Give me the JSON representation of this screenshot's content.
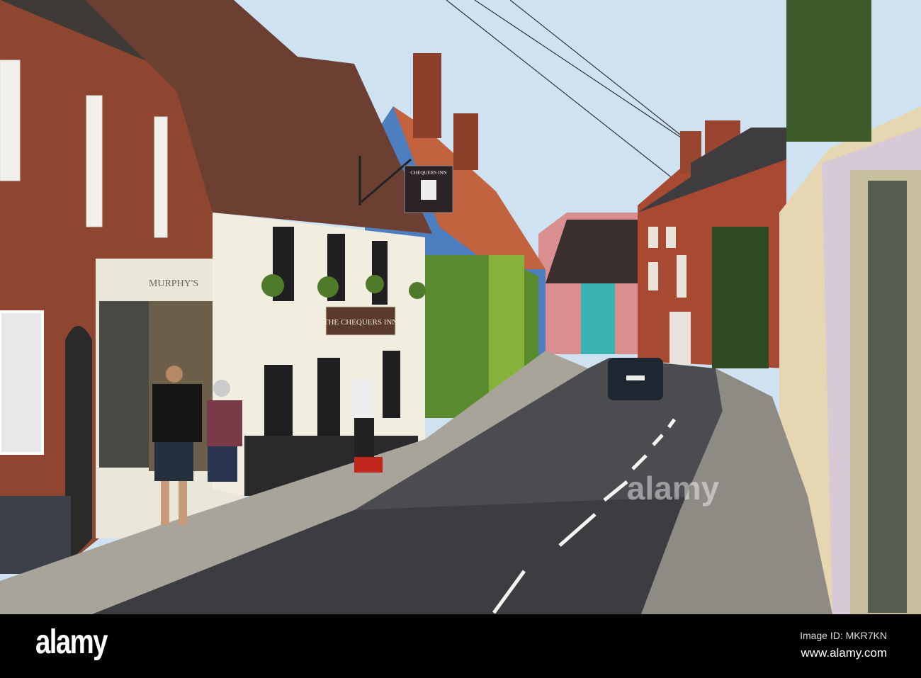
{
  "photo": {
    "subject": "Village street with The Chequers Inn",
    "signs": {
      "pub_board": "THE CHEQUERS INN",
      "hanging_sign": "CHEQUERS INN",
      "shop_fascia": "MURPHY'S"
    },
    "colors": {
      "sky": "#cfe2f2",
      "brick": "#8e4630",
      "road": "#4b4c4f",
      "pavement": "#a9a49a",
      "ivy": "#5a8a2e"
    }
  },
  "watermark": {
    "text": "alamy"
  },
  "footer": {
    "logo": "alamy",
    "image_id": "Image ID: MKR7KN",
    "url": "www.alamy.com"
  }
}
